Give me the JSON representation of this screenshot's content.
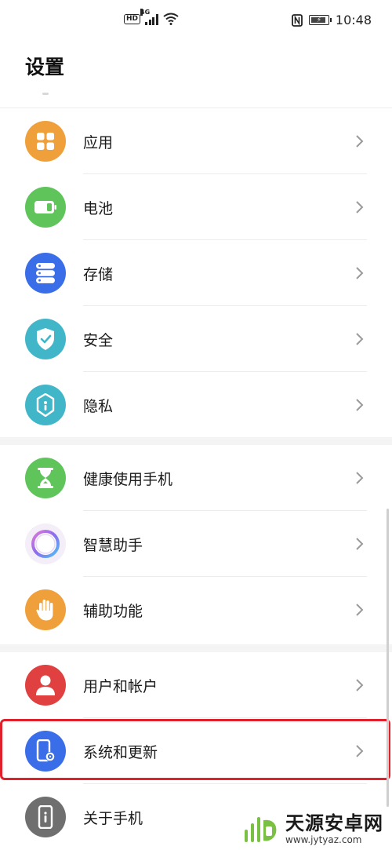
{
  "status_bar": {
    "hd": "HD",
    "network": "4G",
    "time": "10:48"
  },
  "header": {
    "title": "设置"
  },
  "groups": [
    {
      "items": [
        {
          "label": "应用",
          "icon": "apps-grid-icon",
          "color": "#f0a03a"
        },
        {
          "label": "电池",
          "icon": "battery-icon",
          "color": "#5fc45a"
        },
        {
          "label": "存储",
          "icon": "storage-icon",
          "color": "#3a6ee8"
        },
        {
          "label": "安全",
          "icon": "shield-check-icon",
          "color": "#41b6c8"
        },
        {
          "label": "隐私",
          "icon": "privacy-lock-icon",
          "color": "#41b6c8"
        }
      ]
    },
    {
      "items": [
        {
          "label": "健康使用手机",
          "icon": "hourglass-icon",
          "color": "#5fc45a"
        },
        {
          "label": "智慧助手",
          "icon": "assistant-ring-icon",
          "color": "#f4eef8"
        },
        {
          "label": "辅助功能",
          "icon": "hand-icon",
          "color": "#f0a03a"
        }
      ]
    },
    {
      "items": [
        {
          "label": "用户和帐户",
          "icon": "user-icon",
          "color": "#e04040"
        },
        {
          "label": "系统和更新",
          "icon": "system-phone-gear-icon",
          "color": "#3a6ee8"
        },
        {
          "label": "关于手机",
          "icon": "phone-info-icon",
          "color": "#6f6f6f"
        }
      ]
    }
  ],
  "watermark": {
    "title": "天源安卓网",
    "url": "www.jytyaz.com"
  },
  "colors": {
    "highlight": "#e0202a",
    "divider": "#ececec",
    "group_gap": "#f4f4f4"
  }
}
